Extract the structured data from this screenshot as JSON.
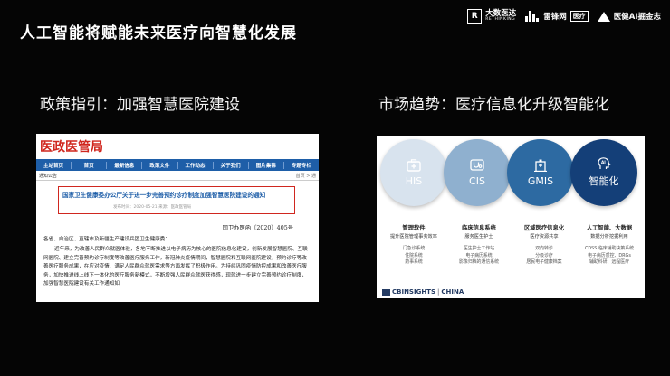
{
  "slide": {
    "title": "人工智能将赋能未来医疗向智慧化发展"
  },
  "logos": {
    "rethinking_name": "大数医达",
    "rethinking_sub": "RETHINKING",
    "leiphone": "雷锋网",
    "leiphone_tag": "医疗",
    "medical_ai": "医健AI掘金志"
  },
  "policy": {
    "heading": "政策指引：加强智慧医院建设",
    "webpage": {
      "bureau": "医政医管局",
      "nav": [
        "主站首页",
        "首页",
        "最新信息",
        "政策文件",
        "工作动态",
        "关于我们",
        "图片集锦",
        "专题专栏"
      ],
      "section": "通知公告",
      "crumb": "首页 > 通",
      "notice_title": "国家卫生健康委办公厅关于进一步完善预约诊疗制度加强智慧医院建设的通知",
      "notice_date": "发布时间：2020-05-21  来源：医政医管局",
      "doc_number": "国卫办医函〔2020〕405号",
      "salutation": "各省、自治区、直辖市及新疆生产建设兵团卫生健康委：",
      "paragraph": "近年来，为改善人民群众就医体验，各地不断推进以电子病历为核心的医院信息化建设，创新发展智慧医院、互联网医院、建立完善预约诊疗制度等改善医疗服务工作，新冠肺炎疫情期间，智慧医院和互联网医院建设，预约诊疗等改善医疗服务成果，在应对疫情、满足人民群众就医需求等方面发挥了积极作用。为持续巩固疫情防控成果和改善医疗服务，加快推进线上线下一体化的医疗服务新模式，不断增强人民群众就医获得感，现就进一步建立完善预约诊疗制度，加强智慧医院建设有关工作通知如"
    }
  },
  "trend": {
    "heading": "市场趋势：医疗信息化升级智能化",
    "circles": [
      {
        "label": "HIS",
        "icon": "medical-kit-icon"
      },
      {
        "label": "CIS",
        "icon": "stethoscope-icon"
      },
      {
        "label": "GMIS",
        "icon": "hospital-building-icon"
      },
      {
        "label": "智能化",
        "icon": "ai-head-icon"
      }
    ],
    "columns": [
      {
        "head": "管理软件",
        "sub": "提升医院管理事务效率",
        "items": [
          "门急诊系统",
          "住院系统",
          "药事系统"
        ]
      },
      {
        "head": "临床信息系统",
        "sub": "服务医生护士",
        "items": [
          "医生护士工作站",
          "电子病历系统",
          "影像归档的通信系统"
        ]
      },
      {
        "head": "区域医疗信息化",
        "sub": "医疗资源共享",
        "items": [
          "双向转诊",
          "分级诊疗",
          "居民电子健康档案"
        ]
      },
      {
        "head": "人工智能、大数据",
        "sub": "数据分析挖掘利用",
        "items": [
          "CDSS 临床辅助决策系统",
          "电子病历质控、DRGs",
          "辅助科研、远程医疗"
        ]
      }
    ],
    "source": {
      "brand": "CBINSIGHTS",
      "region": "CHINA"
    }
  }
}
